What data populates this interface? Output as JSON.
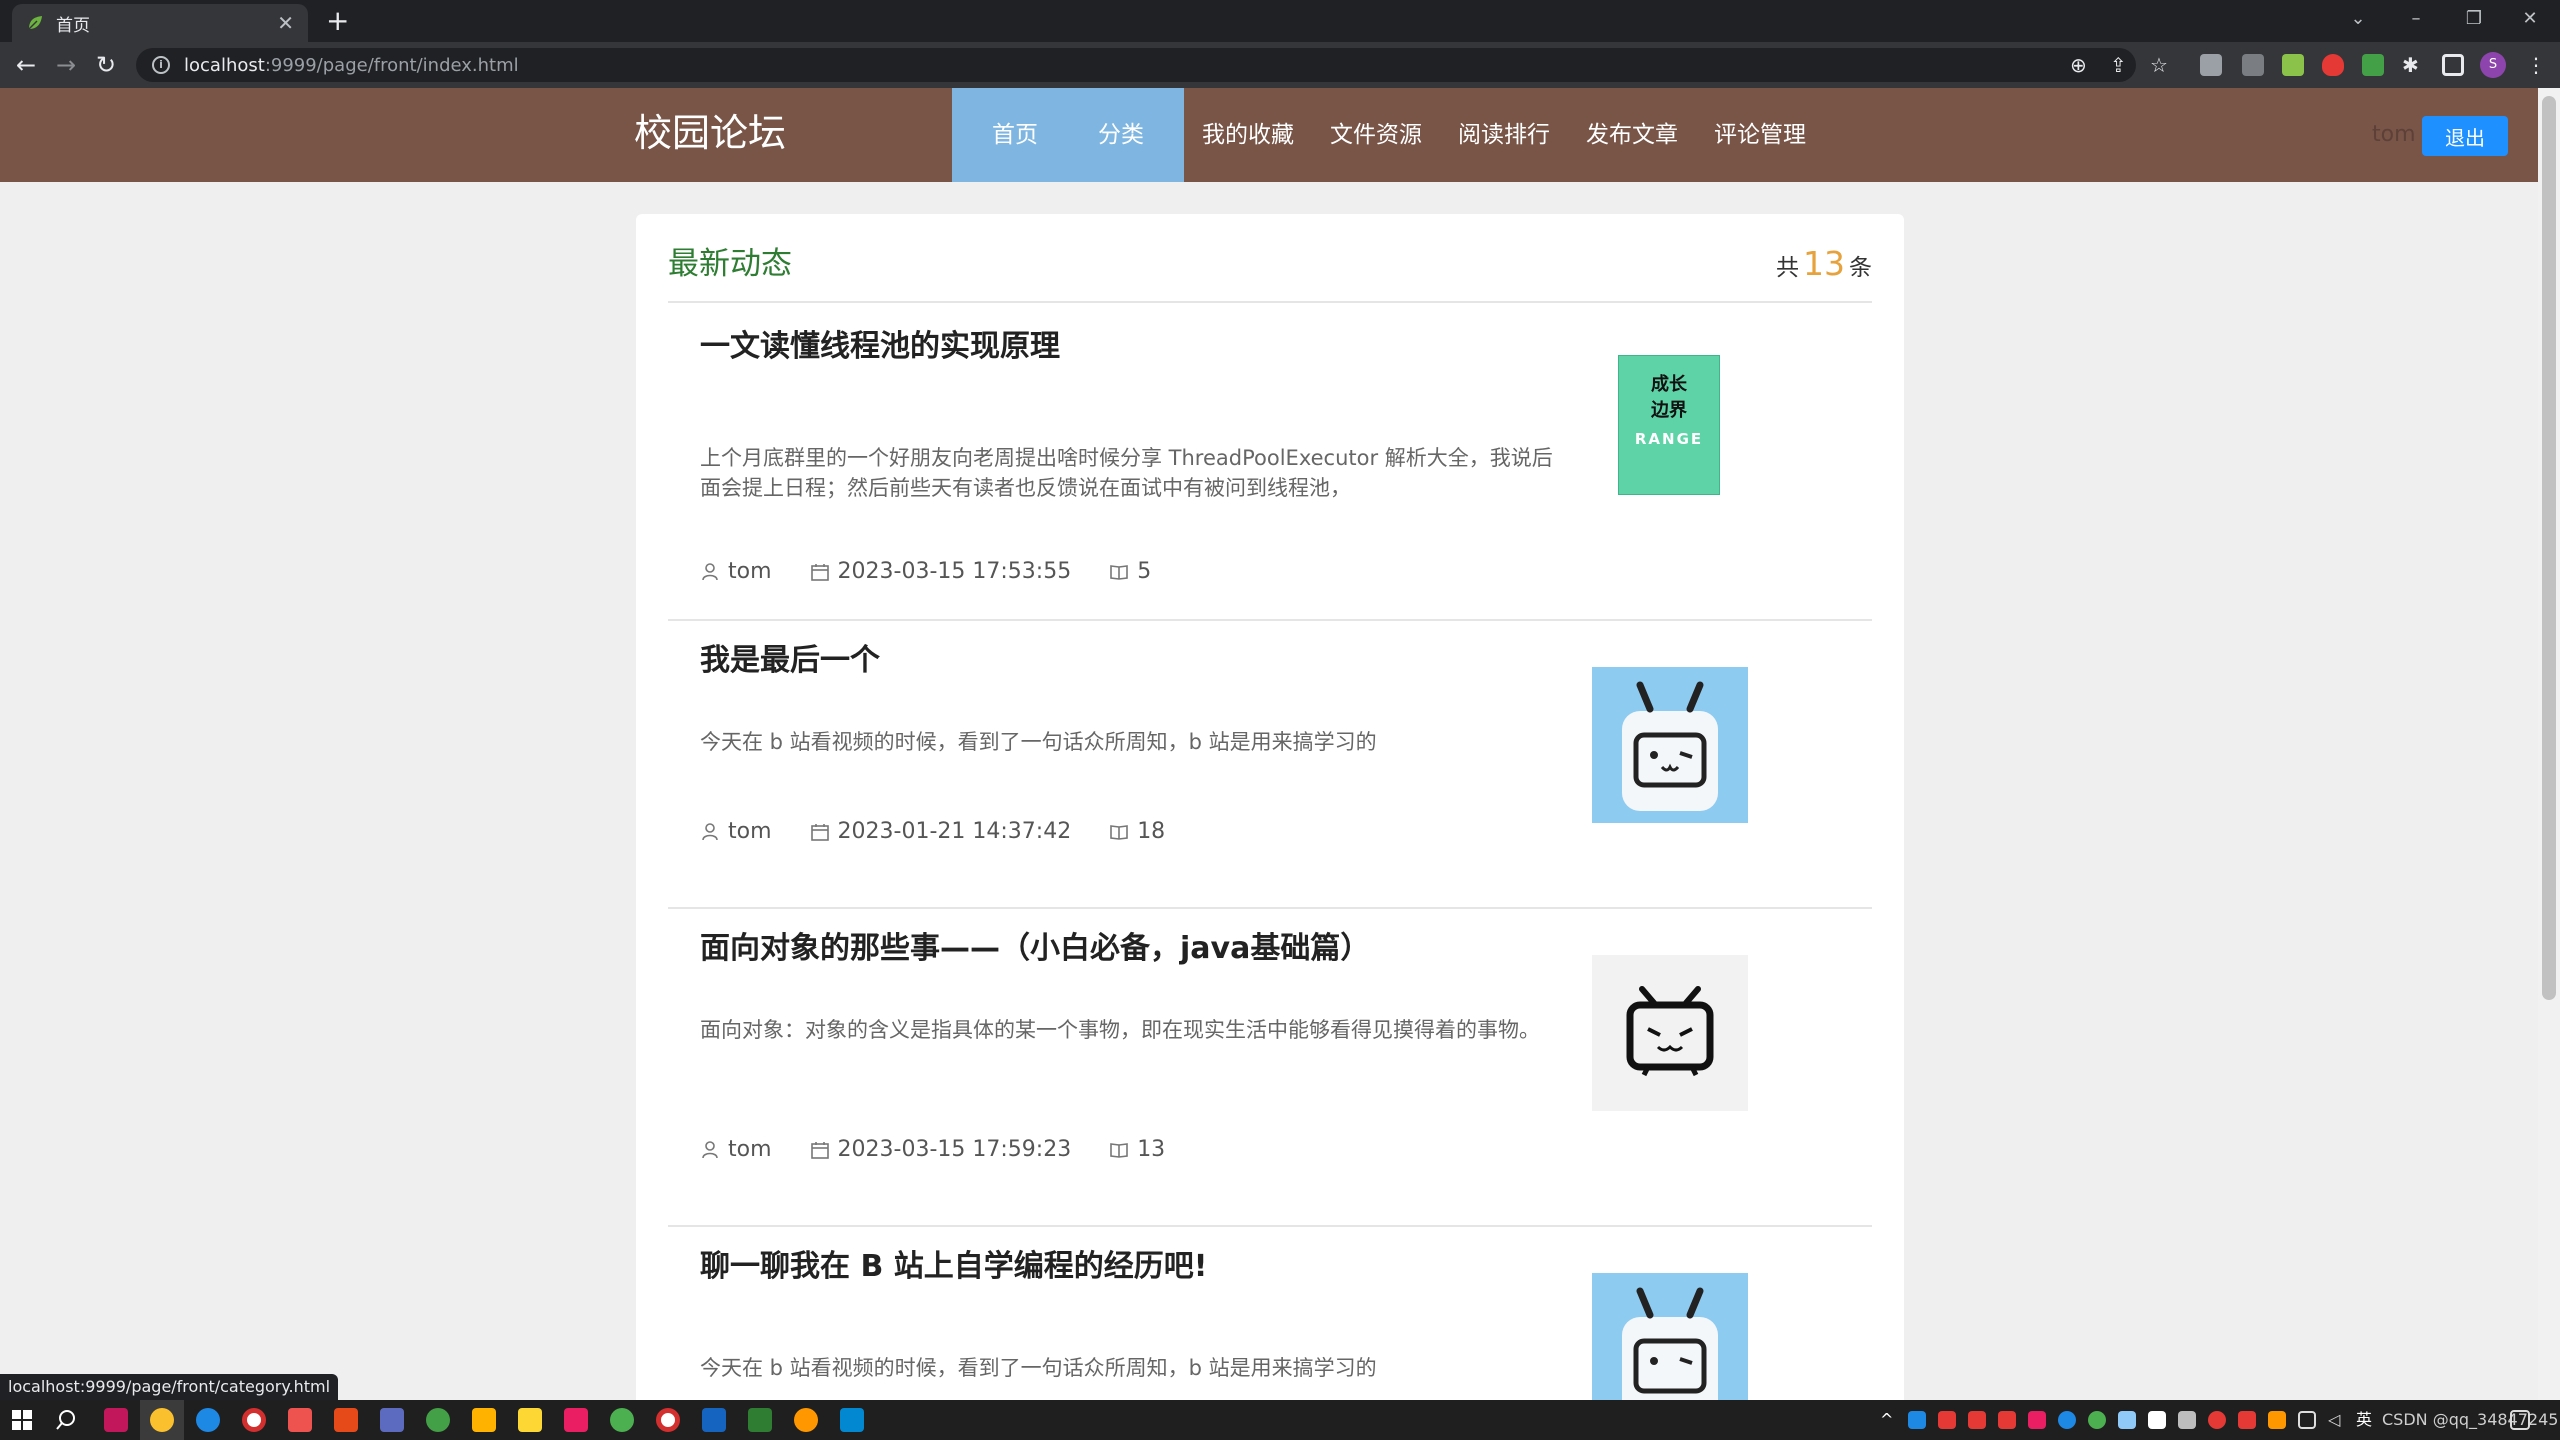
{
  "browser": {
    "tab_title": "首页",
    "url_host": "localhost",
    "url_path": ":9999/page/front/index.html",
    "status_url": "localhost:9999/page/front/category.html",
    "profile_initial": "S"
  },
  "site": {
    "title": "校园论坛",
    "nav": [
      {
        "label": "首页"
      },
      {
        "label": "分类"
      },
      {
        "label": "我的收藏"
      },
      {
        "label": "文件资源"
      },
      {
        "label": "阅读排行"
      },
      {
        "label": "发布文章"
      },
      {
        "label": "评论管理"
      }
    ],
    "user": "tom",
    "logout_label": "退出"
  },
  "feed": {
    "title": "最新动态",
    "count_prefix": "共",
    "count": "13",
    "count_suffix": "条",
    "articles": [
      {
        "title": "一文读懂线程池的实现原理",
        "excerpt": "上个月底群里的一个好朋友向老周提出啥时候分享 ThreadPoolExecutor 解析大全，我说后面会提上日程；然后前些天有读者也反馈说在面试中有被问到线程池，",
        "author": "tom",
        "date": "2023-03-15 17:53:55",
        "views": "5",
        "thumb_text_1": "成长",
        "thumb_text_2": "边界",
        "thumb_text_3": "RANGE"
      },
      {
        "title": "我是最后一个",
        "excerpt": "今天在 b 站看视频的时候，看到了一句话众所周知，b 站是用来搞学习的",
        "author": "tom",
        "date": "2023-01-21 14:37:42",
        "views": "18"
      },
      {
        "title": "面向对象的那些事——（小白必备，java基础篇）",
        "excerpt": "面向对象：对象的含义是指具体的某一个事物，即在现实生活中能够看得见摸得着的事物。",
        "author": "tom",
        "date": "2023-03-15 17:59:23",
        "views": "13"
      },
      {
        "title": "聊一聊我在 B 站上自学编程的经历吧!",
        "excerpt": "今天在 b 站看视频的时候，看到了一句话众所周知，b 站是用来搞学习的"
      }
    ]
  },
  "taskbar": {
    "ime_text": "英",
    "clock_text": "CSDN @qq_34847245"
  },
  "colors": {
    "header_bg": "#795548",
    "nav_active_bg": "#7fb6e1",
    "logout_bg": "#1e90ff",
    "feed_title": "#2e7d32",
    "count_num": "#e6a23c"
  },
  "icons": {
    "author": "user-icon",
    "date": "calendar-icon",
    "views": "book-icon"
  }
}
